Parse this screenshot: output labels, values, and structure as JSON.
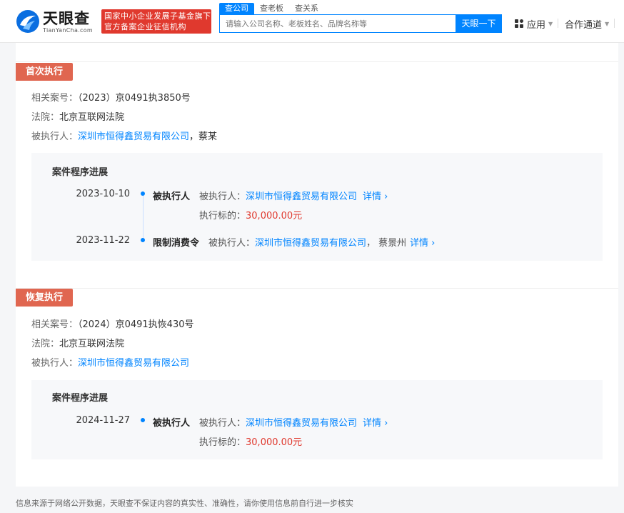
{
  "header": {
    "logo_cn": "天眼查",
    "logo_en": "TianYanCha.com",
    "badge_line1": "国家中小企业发展子基金旗下",
    "badge_line2": "官方备案企业征信机构",
    "tabs": [
      "查公司",
      "查老板",
      "查关系"
    ],
    "search_placeholder": "请输入公司名称、老板姓名、品牌名称等",
    "search_button": "天眼一下",
    "nav_app": "应用",
    "nav_coop": "合作通道"
  },
  "sections": [
    {
      "tag": "首次执行",
      "case_label": "相关案号：",
      "case_no": "（2023）京0491执3850号",
      "court_label": "法院：",
      "court": "北京互联网法院",
      "party_label": "被执行人：",
      "party_company": "深圳市恒得鑫贸易有限公司",
      "party_sep": "，",
      "party_person": "蔡某",
      "progress_title": "案件程序进展",
      "timeline": [
        {
          "date": "2023-10-10",
          "type": "被执行人",
          "party_label": "被执行人：",
          "party": "深圳市恒得鑫贸易有限公司",
          "extra": "",
          "detail": "详情",
          "amount_label": "执行标的：",
          "amount": "30,000.00元"
        },
        {
          "date": "2023-11-22",
          "type": "限制消费令",
          "party_label": "被执行人：",
          "party": "深圳市恒得鑫贸易有限公司",
          "extra": "，  蔡景州",
          "detail": "详情"
        }
      ]
    },
    {
      "tag": "恢复执行",
      "case_label": "相关案号：",
      "case_no": "（2024）京0491执恢430号",
      "court_label": "法院：",
      "court": "北京互联网法院",
      "party_label": "被执行人：",
      "party_company": "深圳市恒得鑫贸易有限公司",
      "progress_title": "案件程序进展",
      "timeline": [
        {
          "date": "2024-11-27",
          "type": "被执行人",
          "party_label": "被执行人：",
          "party": "深圳市恒得鑫贸易有限公司",
          "detail": "详情",
          "amount_label": "执行标的：",
          "amount": "30,000.00元"
        }
      ]
    }
  ],
  "footer": "信息来源于网络公开数据，天眼查不保证内容的真实性、准确性，请你使用信息前自行进一步核实",
  "colors": {
    "accent": "#0084ff",
    "tag": "#e06650",
    "amount": "#e0392e"
  }
}
